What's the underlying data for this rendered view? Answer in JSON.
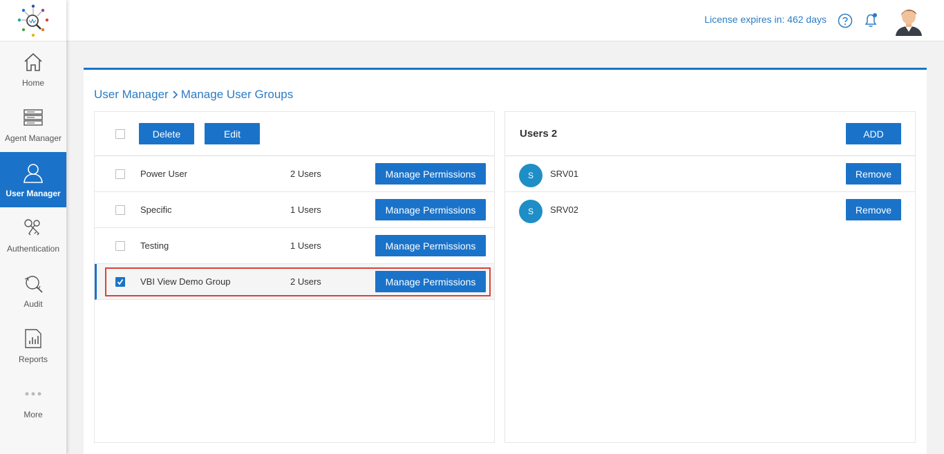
{
  "sidebar": {
    "items": [
      {
        "label": "Home",
        "icon": "home-icon",
        "active": false
      },
      {
        "label": "Agent Manager",
        "icon": "server-icon",
        "active": false
      },
      {
        "label": "User Manager",
        "icon": "user-icon",
        "active": true
      },
      {
        "label": "Authentication",
        "icon": "keys-icon",
        "active": false
      },
      {
        "label": "Audit",
        "icon": "audit-search-icon",
        "active": false
      },
      {
        "label": "Reports",
        "icon": "report-chart-icon",
        "active": false
      },
      {
        "label": "More",
        "icon": "more-dots-icon",
        "active": false
      }
    ]
  },
  "header": {
    "license_text": "License expires in: 462 days"
  },
  "breadcrumb": {
    "parent": "User Manager",
    "current": "Manage User Groups"
  },
  "groups_panel": {
    "delete_label": "Delete",
    "edit_label": "Edit",
    "groups": [
      {
        "name": "Power User",
        "count": "2 Users",
        "action": "Manage Permissions",
        "checked": false
      },
      {
        "name": "Specific",
        "count": "1 Users",
        "action": "Manage Permissions",
        "checked": false
      },
      {
        "name": "Testing",
        "count": "1 Users",
        "action": "Manage Permissions",
        "checked": false
      },
      {
        "name": "VBI View Demo Group",
        "count": "2 Users",
        "action": "Manage Permissions",
        "checked": true
      }
    ]
  },
  "users_panel": {
    "title": "Users 2",
    "add_label": "ADD",
    "users": [
      {
        "initial": "S",
        "name": "SRV01",
        "action": "Remove"
      },
      {
        "initial": "S",
        "name": "SRV02",
        "action": "Remove"
      }
    ]
  },
  "colors": {
    "accent": "#1a73c9",
    "link": "#2b7bc4",
    "highlight_border": "#d9413a",
    "avatar_bg": "#1f8ec6"
  }
}
